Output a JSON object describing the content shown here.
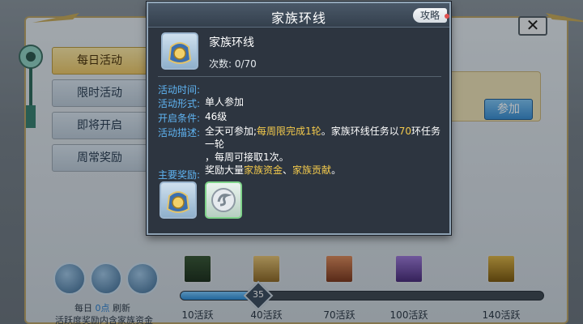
{
  "popup": {
    "title": "家族环线",
    "guide_label": "攻略",
    "item_name": "家族环线",
    "count_text": "次数: 0/70",
    "fields": {
      "time_label": "活动时间:",
      "form_label": "活动形式:",
      "form_value": "单人参加",
      "condition_label": "开启条件:",
      "condition_value": "46级",
      "desc_label": "活动描述:",
      "desc_1": "全天可参加;",
      "desc_2": "每周限完成1轮",
      "desc_3": "。家族环线任务以",
      "desc_4": "70",
      "desc_5": "环任务一轮",
      "desc_line2": "，每周可接取1次。",
      "desc_6": "奖励大量",
      "desc_7": "家族资金",
      "desc_8": "、",
      "desc_9": "家族贡献",
      "desc_10": "。"
    },
    "rewards_label": "主要奖励:",
    "rewards": [
      {
        "icon": "family-fund-bag-icon"
      },
      {
        "icon": "silver-swirl-coin-icon"
      }
    ]
  },
  "sidebar": {
    "tabs": [
      {
        "label": "每日活动",
        "active": true
      },
      {
        "label": "限时活动",
        "active": false
      },
      {
        "label": "即将开启",
        "active": false
      },
      {
        "label": "周常奖励",
        "active": false
      }
    ]
  },
  "main": {
    "join_label": "参加",
    "close_label": "✕",
    "bottom": {
      "line1_a": "每日",
      "line1_b": "0点",
      "line1_c": "刷新",
      "line2": "活跃度奖励内含家族资金"
    },
    "progress": {
      "current": "35",
      "fraction": 0.25
    },
    "milestones": [
      {
        "label": "10活跃",
        "icon": "claimed-chest-icon"
      },
      {
        "label": "40活跃",
        "icon": "scroll-icon"
      },
      {
        "label": "70活跃",
        "icon": "pouch-icon"
      },
      {
        "label": "100活跃",
        "icon": "purple-gem-icon"
      },
      {
        "label": "140活跃",
        "icon": "gold-coin-icon"
      }
    ]
  },
  "colors": {
    "label_blue": "#5fb4f2",
    "highlight_yellow": "#f2c94c",
    "popup_bg": "#2d3540"
  }
}
